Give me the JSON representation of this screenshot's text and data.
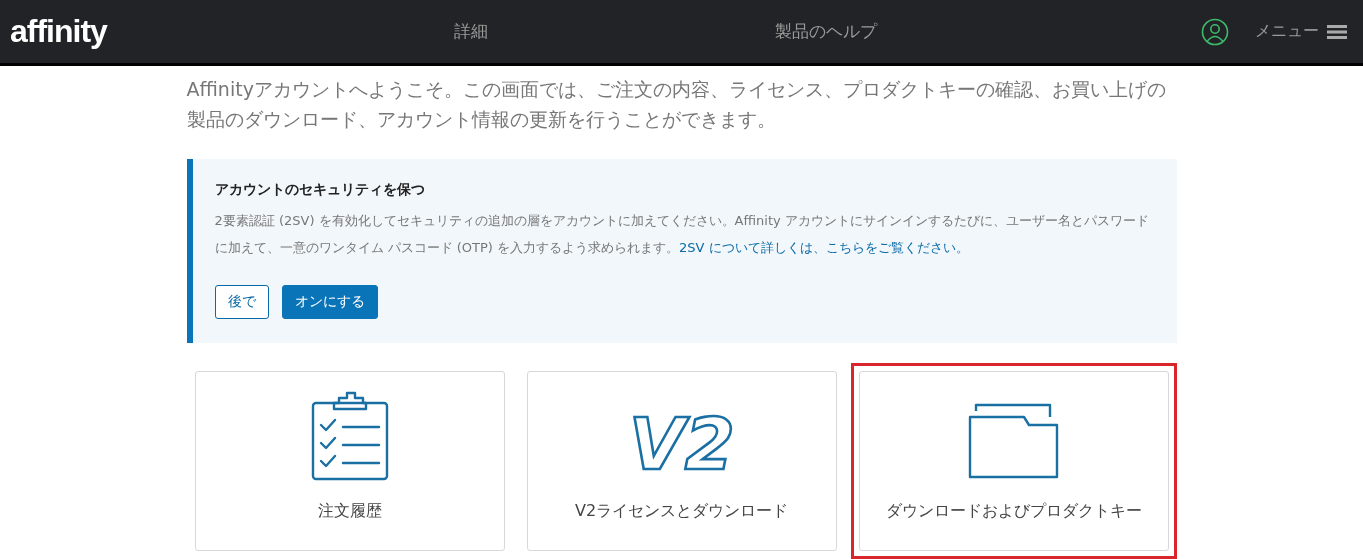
{
  "header": {
    "logo": "affinity",
    "nav": [
      {
        "label": "詳細"
      },
      {
        "label": "製品のヘルプ"
      }
    ],
    "menu_label": "メニュー"
  },
  "intro": "Affinityアカウントへようこそ。この画面では、ご注文の内容、ライセンス、プロダクトキーの確認、お買い上げの製品のダウンロード、アカウント情報の更新を行うことができます。",
  "notice": {
    "title": "アカウントのセキュリティを保つ",
    "body": "2要素認証 (2SV) を有効化してセキュリティの追加の層をアカウントに加えてください。Affinity アカウントにサインインするたびに、ユーザー名とパスワードに加えて、一意のワンタイム パスコード (OTP) を入力するよう求められます。",
    "link": "2SV について詳しくは、こちらをご覧ください。",
    "buttons": [
      {
        "label": "後で",
        "kind": "outline"
      },
      {
        "label": "オンにする",
        "kind": "primary"
      }
    ]
  },
  "cards": [
    {
      "label": "注文履歴",
      "kind": "clipboard",
      "highlighted": false
    },
    {
      "label": "V2ライセンスとダウンロード",
      "kind": "badge",
      "badge_text": "V2",
      "highlighted": false
    },
    {
      "label": "ダウンロードおよびプロダクトキー",
      "kind": "folder",
      "highlighted": true
    }
  ]
}
